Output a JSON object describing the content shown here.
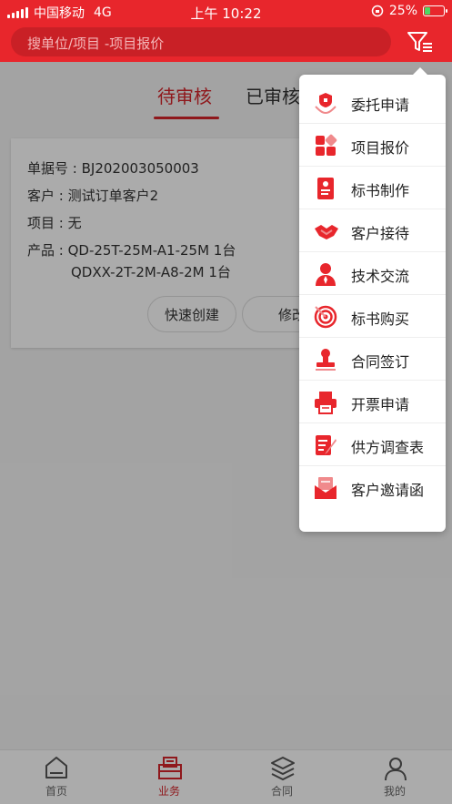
{
  "status_bar": {
    "carrier": "中国移动",
    "network": "4G",
    "time": "上午 10:22",
    "battery": "25%"
  },
  "search": {
    "placeholder": "搜单位/项目  -项目报价"
  },
  "tabs": [
    {
      "label": "待审核"
    },
    {
      "label": "已审核"
    }
  ],
  "card": {
    "doc_no": {
      "label": "单据号 :",
      "value": "BJ202003050003"
    },
    "customer": {
      "label": "客户 :",
      "value": "测试订单客户2"
    },
    "project": {
      "label": "项目 :",
      "value": "无"
    },
    "product": {
      "label": "产品 :",
      "value_line1": "QD-25T-25M-A1-25M 1台",
      "value_line2": "QDXX-2T-2M-A8-2M 1台"
    },
    "buttons": [
      {
        "label": "快速创建"
      },
      {
        "label": "修改"
      }
    ]
  },
  "menu": {
    "items": [
      {
        "label": "委托申请",
        "icon": "entrust-hand-icon"
      },
      {
        "label": "项目报价",
        "icon": "quote-grid-icon"
      },
      {
        "label": "标书制作",
        "icon": "document-icon"
      },
      {
        "label": "客户接待",
        "icon": "handshake-icon"
      },
      {
        "label": "技术交流",
        "icon": "person-tie-icon"
      },
      {
        "label": "标书购买",
        "icon": "target-icon"
      },
      {
        "label": "合同签订",
        "icon": "stamp-icon"
      },
      {
        "label": "开票申请",
        "icon": "printer-icon"
      },
      {
        "label": "供方调查表",
        "icon": "form-pen-icon"
      },
      {
        "label": "客户邀请函",
        "icon": "envelope-icon"
      }
    ]
  },
  "tabbar": {
    "items": [
      {
        "label": "首页",
        "icon": "home-icon"
      },
      {
        "label": "业务",
        "icon": "briefcase-icon"
      },
      {
        "label": "合同",
        "icon": "layers-icon"
      },
      {
        "label": "我的",
        "icon": "person-icon"
      }
    ],
    "active_index": 1
  },
  "colors": {
    "brand_red": "#e8262c",
    "active_red": "#d6242a",
    "battery_green": "#4cd964"
  }
}
